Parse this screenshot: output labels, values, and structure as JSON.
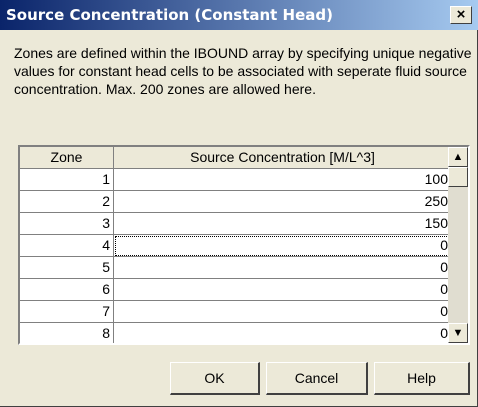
{
  "title": "Source Concentration (Constant Head)",
  "close_label": "×",
  "description": "Zones are defined within the IBOUND array by specifying unique negative values for constant head cells to be associated with seperate fluid source concentration. Max. 200 zones are allowed here.",
  "table": {
    "headers": [
      "Zone",
      "Source Concentration [M/L^3]"
    ],
    "rows": [
      {
        "zone": "1",
        "value": "100"
      },
      {
        "zone": "2",
        "value": "250"
      },
      {
        "zone": "3",
        "value": "150"
      },
      {
        "zone": "4",
        "value": "0"
      },
      {
        "zone": "5",
        "value": "0"
      },
      {
        "zone": "6",
        "value": "0"
      },
      {
        "zone": "7",
        "value": "0"
      },
      {
        "zone": "8",
        "value": "0"
      }
    ],
    "selected_row": 4
  },
  "scroll": {
    "up": "▲",
    "down": "▼"
  },
  "buttons": {
    "ok": "OK",
    "cancel": "Cancel",
    "help": "Help"
  }
}
